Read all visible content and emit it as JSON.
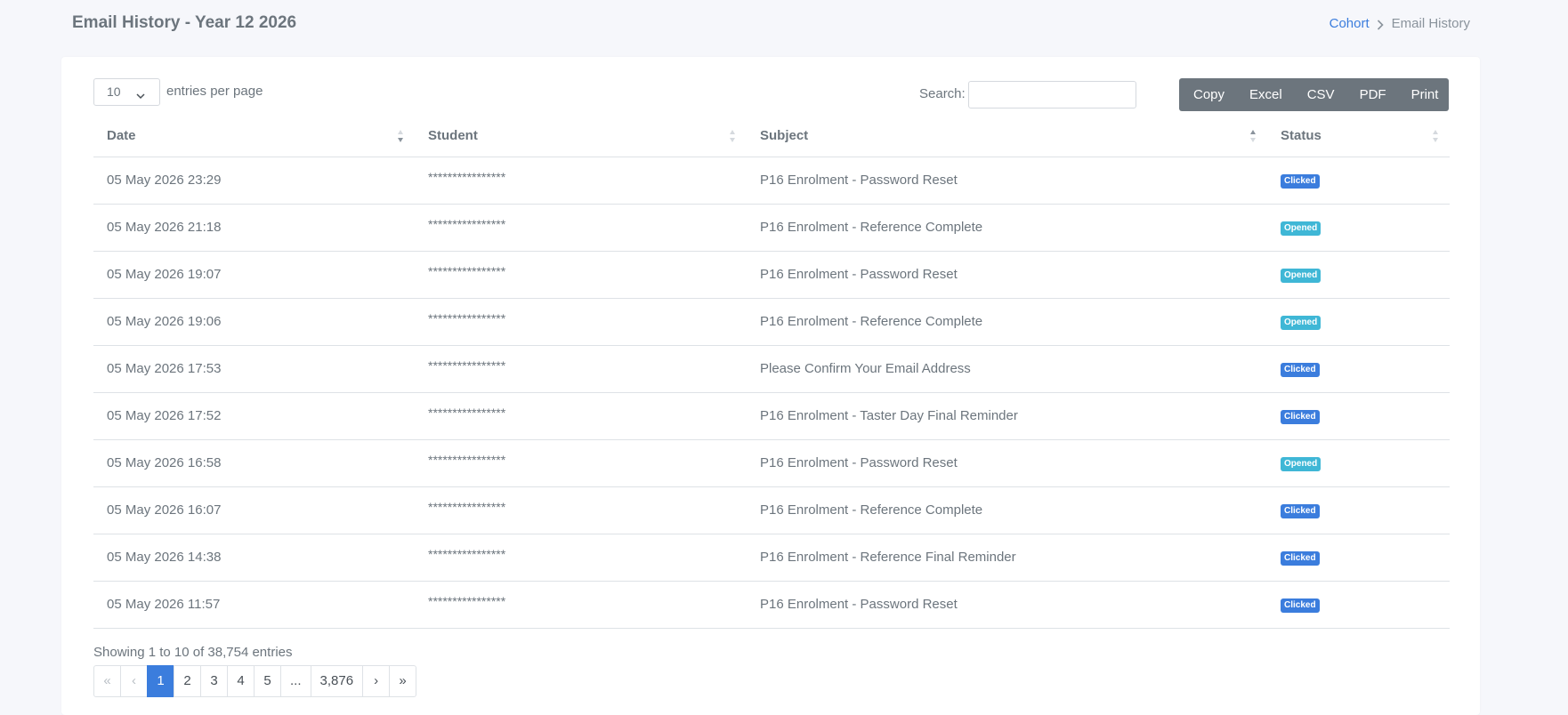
{
  "header": {
    "title": "Email History - Year 12 2026",
    "breadcrumb": {
      "parent": "Cohort",
      "current": "Email History"
    }
  },
  "controls": {
    "length_value": "10",
    "length_label": "entries per page",
    "search_label": "Search:",
    "search_value": "",
    "buttons": [
      "Copy",
      "Excel",
      "CSV",
      "PDF",
      "Print"
    ]
  },
  "table": {
    "columns": [
      "Date",
      "Student",
      "Subject",
      "Status"
    ],
    "sorted_column": "Subject",
    "rows": [
      {
        "date": "05 May 2026 23:29",
        "student": "****************",
        "subject": "P16 Enrolment - Password Reset",
        "status": "Clicked"
      },
      {
        "date": "05 May 2026 21:18",
        "student": "****************",
        "subject": "P16 Enrolment - Reference Complete",
        "status": "Opened"
      },
      {
        "date": "05 May 2026 19:07",
        "student": "****************",
        "subject": "P16 Enrolment - Password Reset",
        "status": "Opened"
      },
      {
        "date": "05 May 2026 19:06",
        "student": "****************",
        "subject": "P16 Enrolment - Reference Complete",
        "status": "Opened"
      },
      {
        "date": "05 May 2026 17:53",
        "student": "****************",
        "subject": "Please Confirm Your Email Address",
        "status": "Clicked"
      },
      {
        "date": "05 May 2026 17:52",
        "student": "****************",
        "subject": "P16 Enrolment - Taster Day Final Reminder",
        "status": "Clicked"
      },
      {
        "date": "05 May 2026 16:58",
        "student": "****************",
        "subject": "P16 Enrolment - Password Reset",
        "status": "Opened"
      },
      {
        "date": "05 May 2026 16:07",
        "student": "****************",
        "subject": "P16 Enrolment - Reference Complete",
        "status": "Clicked"
      },
      {
        "date": "05 May 2026 14:38",
        "student": "****************",
        "subject": "P16 Enrolment - Reference Final Reminder",
        "status": "Clicked"
      },
      {
        "date": "05 May 2026 11:57",
        "student": "****************",
        "subject": "P16 Enrolment - Password Reset",
        "status": "Clicked"
      }
    ]
  },
  "footer": {
    "info": "Showing 1 to 10 of 38,754 entries",
    "pages": [
      "«",
      "‹",
      "1",
      "2",
      "3",
      "4",
      "5",
      "...",
      "3,876",
      "›",
      "»"
    ],
    "active_page": "1"
  },
  "colors": {
    "accent": "#3b7ddd",
    "opened": "#3fb7d6",
    "button_group": "#6c757d"
  }
}
